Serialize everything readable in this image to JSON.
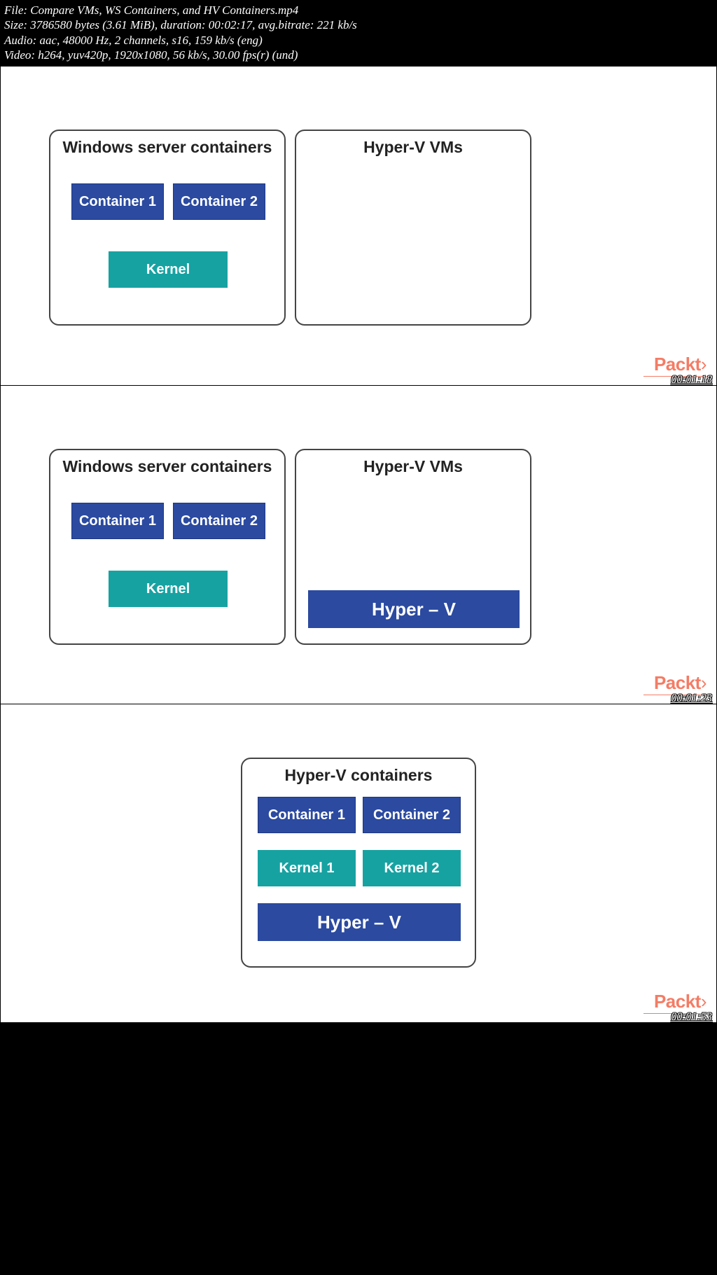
{
  "header": {
    "line1": "File: Compare VMs, WS Containers, and HV Containers.mp4",
    "line2": "Size: 3786580 bytes (3.61 MiB), duration: 00:02:17, avg.bitrate: 221 kb/s",
    "line3": "Audio: aac, 48000 Hz, 2 channels, s16, 159 kb/s (eng)",
    "line4": "Video: h264, yuv420p, 1920x1080, 56 kb/s, 30.00 fps(r) (und)"
  },
  "logo": "Packt",
  "logoBracket": "›",
  "frames": [
    {
      "timecode": "00:01:18",
      "leftPanel": {
        "title": "Windows server containers",
        "container1": "Container 1",
        "container2": "Container 2",
        "kernel": "Kernel"
      },
      "rightPanel": {
        "title": "Hyper-V VMs"
      }
    },
    {
      "timecode": "00:01:23",
      "leftPanel": {
        "title": "Windows server containers",
        "container1": "Container 1",
        "container2": "Container 2",
        "kernel": "Kernel"
      },
      "rightPanel": {
        "title": "Hyper-V VMs",
        "hyperv": "Hyper – V"
      }
    },
    {
      "timecode": "00:01:53",
      "centerPanel": {
        "title": "Hyper-V containers",
        "container1": "Container 1",
        "container2": "Container 2",
        "kernel1": "Kernel 1",
        "kernel2": "Kernel 2",
        "hyperv": "Hyper – V"
      }
    }
  ]
}
